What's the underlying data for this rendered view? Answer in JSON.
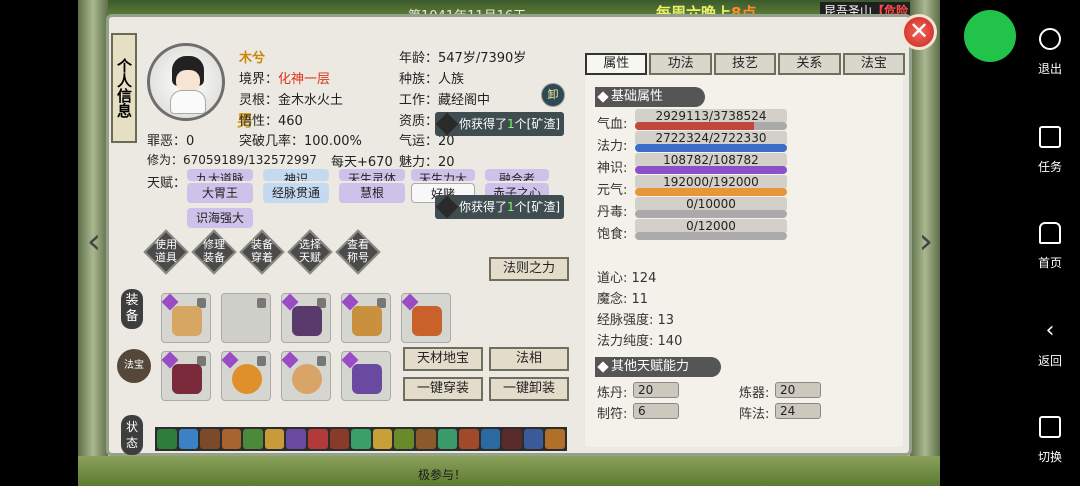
{
  "topbar": {
    "date": "第1041年11月16天",
    "event_prefix": "每周六晚上",
    "event_highlight": "8点",
    "place": "昆吾圣山",
    "place_tag": "【危险"
  },
  "panel": {
    "title": "个人信息",
    "gender": "男",
    "name": "木兮",
    "fields": {
      "realm_label": "境界：",
      "realm_value": "化神一层",
      "root_label": "灵根：",
      "root_value": "金木水火土",
      "wisdom_label": "悟性：",
      "wisdom_value": "460",
      "sin_label": "罪恶：",
      "sin_value": "0",
      "breakthrough_label": "突破几率：",
      "breakthrough_value": "100.00%",
      "cultivation_label": "修为：",
      "cultivation_value": "67059189/132572997",
      "per_day_label": "每天+",
      "per_day_value": "670",
      "talent_label": "天赋：",
      "age_label": "年龄：",
      "age_value": "547岁/7390岁",
      "race_label": "种族：",
      "race_value": "人族",
      "work_label": "工作：",
      "work_value": "藏经阁中",
      "aptitude_label": "资质：",
      "aptitude_value": "1",
      "luck_label": "气运：",
      "luck_value": "20",
      "charm_label": "魅力：",
      "charm_value": "20"
    },
    "unload_label": "卸",
    "talents_partial": [
      "九大道脉",
      "神识",
      "天生灵体",
      "天生力大",
      "融合者"
    ],
    "talents": [
      "大胃王",
      "经脉贯通",
      "慧根",
      "好赌",
      "赤子之心",
      "识海强大"
    ],
    "toasts": [
      {
        "prefix": "你获得了",
        "count": "1",
        "suffix": "个[矿渣]"
      },
      {
        "prefix": "你获得了",
        "count": "1",
        "suffix": "个[矿渣]"
      }
    ],
    "actions": [
      "使用道具",
      "修理装备",
      "装备穿着",
      "选择天赋",
      "查看称号"
    ],
    "law_button": "法则之力",
    "equip_label": "装备",
    "treasure_label": "法宝",
    "status_label": "状态",
    "buttons": {
      "treasure": "天材地宝",
      "dharma": "法相",
      "equip_all": "一键穿装",
      "unequip_all": "一键卸装"
    }
  },
  "right": {
    "tabs": [
      "属性",
      "功法",
      "技艺",
      "关系",
      "法宝"
    ],
    "basic_title": "基础属性",
    "stats": [
      {
        "label": "气血:",
        "value": "2929113/3738524",
        "ratio": 0.78,
        "color": "#c0463e"
      },
      {
        "label": "法力:",
        "value": "2722324/2722330",
        "ratio": 1.0,
        "color": "#3b6ec8"
      },
      {
        "label": "神识:",
        "value": "108782/108782",
        "ratio": 1.0,
        "color": "#8a52c8"
      },
      {
        "label": "元气:",
        "value": "192000/192000",
        "ratio": 1.0,
        "color": "#e8963a"
      },
      {
        "label": "丹毒:",
        "value": "0/10000",
        "ratio": 0,
        "color": "#888"
      },
      {
        "label": "饱食:",
        "value": "0/12000",
        "ratio": 0,
        "color": "#888"
      }
    ],
    "plain_stats": [
      {
        "label": "道心:",
        "value": "124"
      },
      {
        "label": "魔念:",
        "value": "11"
      },
      {
        "label": "经脉强度:",
        "value": "13"
      },
      {
        "label": "法力纯度:",
        "value": "140"
      }
    ],
    "other_title": "其他天赋能力",
    "abilities": [
      {
        "label": "炼丹:",
        "value": "20"
      },
      {
        "label": "炼器:",
        "value": "20"
      },
      {
        "label": "制符:",
        "value": "6"
      },
      {
        "label": "阵法:",
        "value": "24"
      }
    ]
  },
  "bottom": {
    "text": "极参与！"
  },
  "system": {
    "items": [
      "退出",
      "任务",
      "首页",
      "返回",
      "切换"
    ]
  }
}
